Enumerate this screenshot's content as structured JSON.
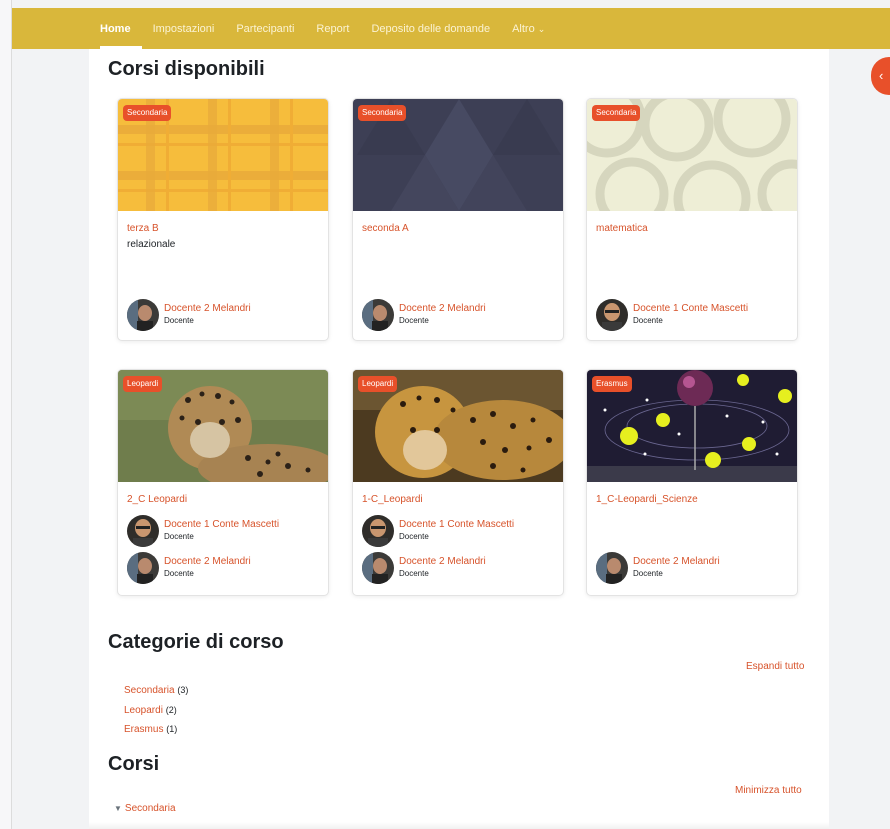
{
  "navbar": {
    "items": [
      {
        "label": "Home",
        "active": true
      },
      {
        "label": "Impostazioni"
      },
      {
        "label": "Partecipanti"
      },
      {
        "label": "Report"
      },
      {
        "label": "Deposito delle domande"
      },
      {
        "label": "Altro"
      }
    ],
    "more_icon": "chevron-down-icon",
    "drawer_icon": "chevron-left-icon",
    "drawer_glyph": "‹"
  },
  "available_courses": {
    "title": "Corsi disponibili",
    "cards": [
      {
        "category": "Secondaria",
        "name": "terza B",
        "summary": "relazionale",
        "image": "yellow-plaid-pattern",
        "teachers": [
          {
            "name": "Docente 2 Melandri",
            "role": "Docente"
          }
        ]
      },
      {
        "category": "Secondaria",
        "name": "seconda A",
        "summary": "",
        "image": "dark-diamond-pattern",
        "teachers": [
          {
            "name": "Docente 2 Melandri",
            "role": "Docente"
          }
        ]
      },
      {
        "category": "Secondaria",
        "name": "matematica",
        "summary": "",
        "image": "cream-circles-pattern",
        "teachers": [
          {
            "name": "Docente 1 Conte Mascetti",
            "role": "Docente"
          }
        ]
      },
      {
        "category": "Leopardi",
        "name": "2_C Leopardi",
        "summary": "",
        "image": "leopard-photo",
        "teachers": [
          {
            "name": "Docente 1 Conte Mascetti",
            "role": "Docente"
          },
          {
            "name": "Docente 2 Melandri",
            "role": "Docente"
          }
        ]
      },
      {
        "category": "Leopardi",
        "name": "1-C_Leopardi",
        "summary": "",
        "image": "jaguar-photo",
        "teachers": [
          {
            "name": "Docente 1 Conte Mascetti",
            "role": "Docente"
          },
          {
            "name": "Docente 2 Melandri",
            "role": "Docente"
          }
        ]
      },
      {
        "category": "Erasmus",
        "name": "1_C-Leopardi_Scienze",
        "summary": "",
        "image": "planets-model-photo",
        "teachers": [
          {
            "name": "Docente 2 Melandri",
            "role": "Docente"
          }
        ]
      }
    ]
  },
  "course_categories": {
    "title": "Categorie di corso",
    "expand_all": "Espandi tutto",
    "items": [
      {
        "label": "Secondaria",
        "count": "(3)"
      },
      {
        "label": "Leopardi",
        "count": "(2)"
      },
      {
        "label": "Erasmus",
        "count": "(1)"
      }
    ]
  },
  "courses": {
    "title": "Corsi",
    "collapse_all": "Minimizza tutto",
    "first_category": "Secondaria",
    "category_icon": "triangle-down-icon",
    "triangle": "▼"
  },
  "colors": {
    "navbar": "#d9b73b",
    "accent": "#e8502a",
    "link": "#d7532b",
    "page_bg": "#f2f3f5"
  }
}
